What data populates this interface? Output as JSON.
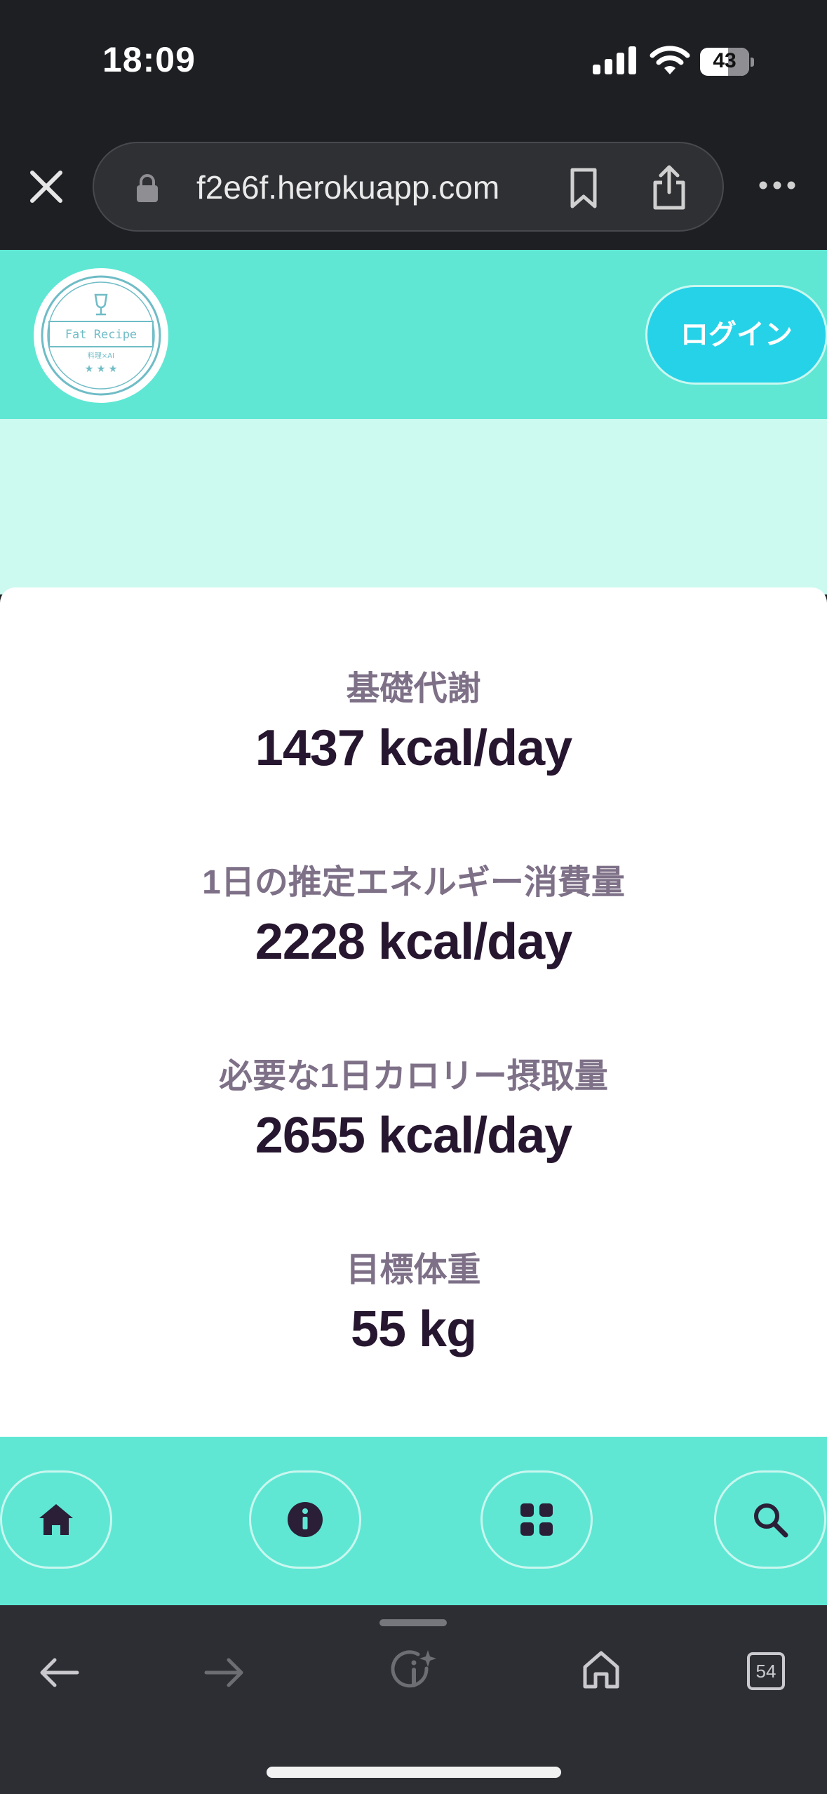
{
  "status_bar": {
    "time": "18:09",
    "battery_percent": "43"
  },
  "browser": {
    "url": "f2e6f.herokuapp.com",
    "tab_count": "54"
  },
  "header": {
    "logo": {
      "title": "Fat Recipe",
      "subtitle": "料理×AI",
      "stars": "★ ★ ★"
    },
    "login_label": "ログイン"
  },
  "stats": [
    {
      "label": "基礎代謝",
      "value": "1437 kcal/day"
    },
    {
      "label": "1日の推定エネルギー消費量",
      "value": "2228 kcal/day"
    },
    {
      "label": "必要な1日カロリー摂取量",
      "value": "2655 kcal/day"
    },
    {
      "label": "目標体重",
      "value": "55 kg"
    }
  ],
  "app_nav": [
    "home-icon",
    "info-icon",
    "grid-icon",
    "search-icon"
  ],
  "colors": {
    "header_bg": "#5fe7d4",
    "hero_bg": "#ccfaf0",
    "login_btn": "#26d2e8",
    "value_text": "#27162f",
    "label_text": "#7d7087"
  }
}
